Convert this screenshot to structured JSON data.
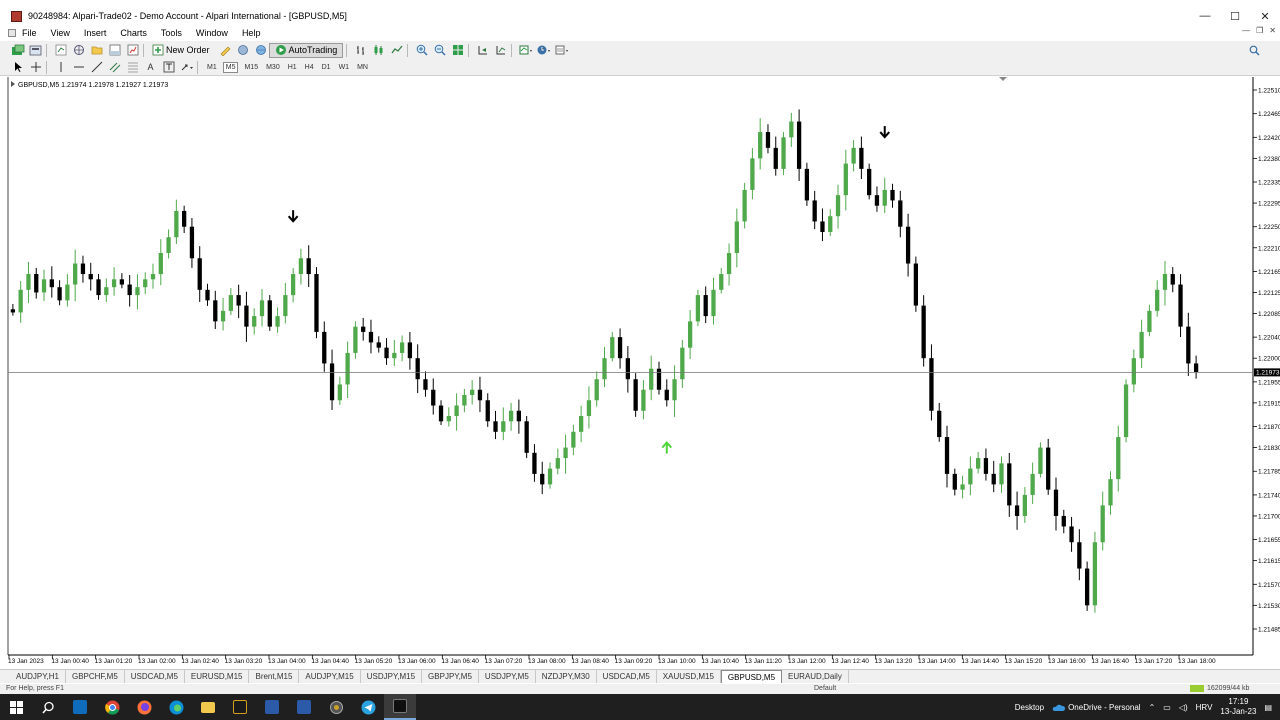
{
  "window": {
    "title": "90248984: Alpari-Trade02 - Demo Account - Alpari International - [GBPUSD,M5]",
    "minimize": "—",
    "maximize": "☐",
    "close": "✕"
  },
  "menu": [
    "File",
    "View",
    "Insert",
    "Charts",
    "Tools",
    "Window",
    "Help"
  ],
  "toolbar": {
    "new_order_label": "New Order",
    "autotrading_label": "AutoTrading",
    "timeframes": [
      "M1",
      "M5",
      "M15",
      "M30",
      "H1",
      "H4",
      "D1",
      "W1",
      "MN"
    ],
    "selected_timeframe": "M5"
  },
  "chart_info": "GBPUSD,M5  1.21974 1.21978 1.21927 1.21973",
  "chart_data": {
    "type": "candlestick",
    "symbol": "GBPUSD",
    "timeframe": "M5",
    "ohlc": [
      1.21974,
      1.21978,
      1.21927,
      1.21973
    ],
    "current_price": 1.21973,
    "current_price_label": "1.21973",
    "ylim": [
      1.21485,
      1.2251
    ],
    "price_ticks": [
      "1.22510",
      "1.22465",
      "1.22420",
      "1.22380",
      "1.22335",
      "1.22295",
      "1.22250",
      "1.22210",
      "1.22165",
      "1.22125",
      "1.22085",
      "1.22040",
      "1.22000",
      "1.21955",
      "1.21915",
      "1.21870",
      "1.21830",
      "1.21785",
      "1.21740",
      "1.21700",
      "1.21655",
      "1.21615",
      "1.21570",
      "1.21530",
      "1.21485"
    ],
    "time_ticks": [
      "13 Jan 2023",
      "13 Jan 00:40",
      "13 Jan 01:20",
      "13 Jan 02:00",
      "13 Jan 02:40",
      "13 Jan 03:20",
      "13 Jan 04:00",
      "13 Jan 04:40",
      "13 Jan 05:20",
      "13 Jan 06:00",
      "13 Jan 06:40",
      "13 Jan 07:20",
      "13 Jan 08:00",
      "13 Jan 08:40",
      "13 Jan 09:20",
      "13 Jan 10:00",
      "13 Jan 10:40",
      "13 Jan 11:20",
      "13 Jan 12:00",
      "13 Jan 12:40",
      "13 Jan 13:20",
      "13 Jan 14:00",
      "13 Jan 14:40",
      "13 Jan 15:20",
      "13 Jan 16:00",
      "13 Jan 16:40",
      "13 Jan 17:20",
      "13 Jan 18:00"
    ],
    "closes": [
      1.22087,
      1.2213,
      1.2216,
      1.22125,
      1.2215,
      1.22135,
      1.2211,
      1.2214,
      1.2218,
      1.2216,
      1.2215,
      1.2212,
      1.22135,
      1.2215,
      1.2214,
      1.2212,
      1.22135,
      1.2215,
      1.2216,
      1.222,
      1.2223,
      1.2228,
      1.2225,
      1.2219,
      1.2213,
      1.2211,
      1.2207,
      1.2209,
      1.2212,
      1.221,
      1.2206,
      1.2208,
      1.2211,
      1.2206,
      1.2208,
      1.2212,
      1.2216,
      1.2219,
      1.2216,
      1.2205,
      1.2199,
      1.2192,
      1.2195,
      1.2201,
      1.2206,
      1.2205,
      1.2203,
      1.2202,
      1.22,
      1.2201,
      1.2203,
      1.22,
      1.2196,
      1.2194,
      1.2191,
      1.2188,
      1.2189,
      1.2191,
      1.2193,
      1.2194,
      1.2192,
      1.2188,
      1.2186,
      1.2188,
      1.219,
      1.2188,
      1.2182,
      1.2178,
      1.2176,
      1.2179,
      1.2181,
      1.2183,
      1.2186,
      1.2189,
      1.2192,
      1.2196,
      1.22,
      1.2204,
      1.22,
      1.2196,
      1.219,
      1.2194,
      1.2198,
      1.2194,
      1.2192,
      1.2196,
      1.2202,
      1.2207,
      1.2212,
      1.2208,
      1.2213,
      1.2216,
      1.222,
      1.2226,
      1.2232,
      1.2238,
      1.2243,
      1.224,
      1.2236,
      1.2242,
      1.2245,
      1.2236,
      1.223,
      1.2226,
      1.2224,
      1.2227,
      1.2231,
      1.2237,
      1.224,
      1.2236,
      1.2231,
      1.2229,
      1.2232,
      1.223,
      1.2225,
      1.2218,
      1.221,
      1.22,
      1.219,
      1.2185,
      1.2178,
      1.2175,
      1.2176,
      1.2179,
      1.2181,
      1.2178,
      1.2176,
      1.218,
      1.2172,
      1.217,
      1.2174,
      1.2178,
      1.2183,
      1.2175,
      1.217,
      1.2168,
      1.2165,
      1.216,
      1.2153,
      1.2165,
      1.2172,
      1.2177,
      1.2185,
      1.2195,
      1.22,
      1.2205,
      1.2209,
      1.2213,
      1.2216,
      1.2214,
      1.2206,
      1.2199,
      1.21973
    ]
  },
  "arrows": [
    {
      "direction": "down",
      "color": "#000000",
      "index": 36
    },
    {
      "direction": "up",
      "color": "#4fd63a",
      "index": 84
    },
    {
      "direction": "down",
      "color": "#000000",
      "index": 112
    }
  ],
  "tabs": [
    "AUDJPY,H1",
    "GBPCHF,M5",
    "USDCAD,M5",
    "EURUSD,M15",
    "Brent,M15",
    "AUDJPY,M15",
    "USDJPY,M15",
    "GBPJPY,M5",
    "USDJPY,M5",
    "NZDJPY,M30",
    "USDCAD,M5",
    "XAUUSD,M15",
    "GBPUSD,M5",
    "EURAUD,Daily"
  ],
  "active_tab": "GBPUSD,M5",
  "status": {
    "help": "For Help, press F1",
    "profile": "Default",
    "traffic": "162099/44 kb"
  },
  "taskbar": {
    "desktop": "Desktop",
    "onedrive": "OneDrive - Personal",
    "language": "HRV",
    "time": "17:19",
    "date": "13-Jan-23"
  },
  "colors": {
    "bull": "#4fa84a",
    "bear": "#000000",
    "up_arrow": "#4fd63a"
  }
}
